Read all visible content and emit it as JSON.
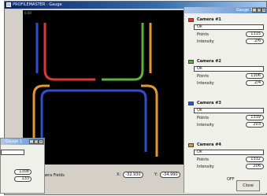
{
  "main_window": {
    "title": "PROFILEMASTER - Gauge",
    "plot_coord": "0.00"
  },
  "panel": {
    "title": "Gauge 1",
    "cameras": [
      {
        "name": "Camera #1",
        "color": "#d83a3a",
        "value": "Ok",
        "points_label": "Points",
        "points": "1315",
        "intensity_label": "Intensity",
        "intensity": "2/6"
      },
      {
        "name": "Camera #2",
        "color": "#5ab43c",
        "value": "Ok",
        "points_label": "Points",
        "points": "1306",
        "intensity_label": "Intensity",
        "intensity": "2/4"
      },
      {
        "name": "Camera #3",
        "color": "#3050c8",
        "value": "Ok",
        "points_label": "Points",
        "points": "1339",
        "intensity_label": "Intensity",
        "intensity": "203"
      },
      {
        "name": "Camera #4",
        "color": "#e09a30",
        "value": "Ok",
        "points_label": "Points",
        "points": "1332",
        "intensity_label": "Intensity",
        "intensity": "206"
      }
    ],
    "off_label": "OFF",
    "close_label": "Close"
  },
  "bottom": {
    "fields_label": "amera Fields",
    "x_label": "X:",
    "x_value": "-32.930",
    "y_label": "Y:",
    "y_value": "-34.990"
  },
  "overlay": {
    "title": "Gauge 1",
    "value1": "1308",
    "value2": "133"
  },
  "profile_colors": {
    "camera1": "#d83a3a",
    "camera2": "#5ab43c",
    "camera3": "#3050c8",
    "camera4": "#e09a30"
  }
}
